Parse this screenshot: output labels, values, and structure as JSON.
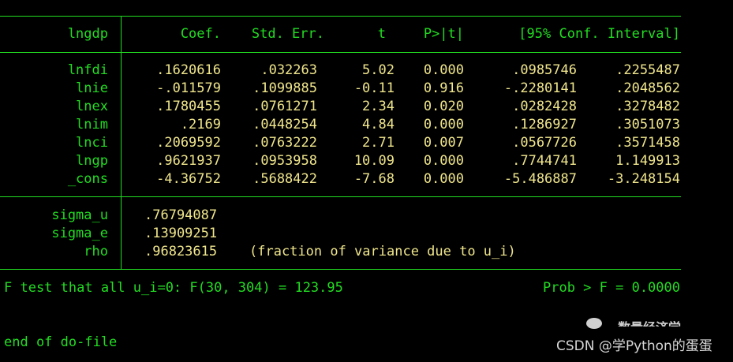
{
  "table": {
    "header": {
      "depvar": "lngdp",
      "coef": "Coef.",
      "stderr": "Std. Err.",
      "t": "t",
      "p": "P>|t|",
      "ci": "[95% Conf. Interval]"
    },
    "rows": [
      {
        "name": "lnfdi",
        "coef": ".1620616",
        "se": ".032263",
        "t": "5.02",
        "p": "0.000",
        "lo": ".0985746",
        "hi": ".2255487"
      },
      {
        "name": "lnie",
        "coef": "-.011579",
        "se": ".1099885",
        "t": "-0.11",
        "p": "0.916",
        "lo": "-.2280141",
        "hi": ".2048562"
      },
      {
        "name": "lnex",
        "coef": ".1780455",
        "se": ".0761271",
        "t": "2.34",
        "p": "0.020",
        "lo": ".0282428",
        "hi": ".3278482"
      },
      {
        "name": "lnim",
        "coef": ".2169",
        "se": ".0448254",
        "t": "4.84",
        "p": "0.000",
        "lo": ".1286927",
        "hi": ".3051073"
      },
      {
        "name": "lnci",
        "coef": ".2069592",
        "se": ".0763222",
        "t": "2.71",
        "p": "0.007",
        "lo": ".0567726",
        "hi": ".3571458"
      },
      {
        "name": "lngp",
        "coef": ".9621937",
        "se": ".0953958",
        "t": "10.09",
        "p": "0.000",
        "lo": ".7744741",
        "hi": "1.149913"
      },
      {
        "name": "_cons",
        "coef": "-4.36752",
        "se": ".5688422",
        "t": "-7.68",
        "p": "0.000",
        "lo": "-5.486887",
        "hi": "-3.248154"
      }
    ],
    "sigma_rows": [
      {
        "name": "sigma_u",
        "value": ".76794087",
        "note": ""
      },
      {
        "name": "sigma_e",
        "value": ".13909251",
        "note": ""
      },
      {
        "name": "rho",
        "value": ".96823615",
        "note": "(fraction of variance due to u_i)"
      }
    ]
  },
  "ftest": {
    "left": "F test that all u_i=0: F(30, 304) = 123.95",
    "right": "Prob > F = 0.0000"
  },
  "end_text": "end of do-file",
  "watermark": {
    "text": "CSDN @学Python的蛋蛋",
    "faded_text": "数量经济学"
  },
  "colors": {
    "background": "#000000",
    "label_green": "#22dd22",
    "value_yellow": "#f0e68c",
    "watermark_gray": "#d8d8d8"
  }
}
